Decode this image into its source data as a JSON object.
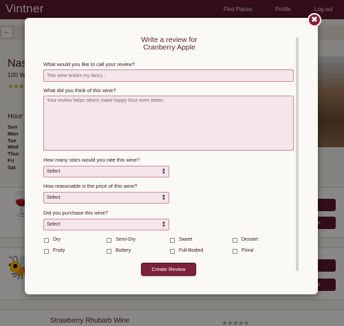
{
  "nav": {
    "brand": "Vintner",
    "find_places": "Find Places",
    "profile": "Profile",
    "logout": "Log out"
  },
  "background": {
    "back_arrow": "←",
    "store_title": "Nas",
    "store_sub": "100 W",
    "store_stars": "★★★",
    "hours_label": "Hour",
    "days": [
      "Sun",
      "Mon",
      "Tue",
      "Wed",
      "Thur",
      "Fri",
      "Sat"
    ],
    "card_button_1": "w",
    "card_button_2": "ws",
    "wine_name": "Strawberry Rhubarb Wine",
    "wine_stars": "★★★★★"
  },
  "modal": {
    "title_line1": "Write a review for",
    "title_line2": "Cranberry Apple",
    "close_glyph": "✖",
    "review_title_label": "What would you like to call your review?",
    "review_title_placeholder": "This wine tickles my fancy...",
    "review_body_label": "What did you think of this wine?",
    "review_body_placeholder": "Your review helps others make happy hour even better.",
    "stars_label": "How many stars would you rate this wine?",
    "stars_value": "Select",
    "price_label": "How reasonable is the price of this wine?",
    "price_value": "Select",
    "purchase_label": "Did you purchase this wine?",
    "purchase_value": "Select",
    "tags": [
      "Dry",
      "Semi-Dry",
      "Sweet",
      "Dessert",
      "Fruity",
      "Buttery",
      "Full-Bodied",
      "Floral"
    ],
    "submit_label": "Create Review"
  }
}
